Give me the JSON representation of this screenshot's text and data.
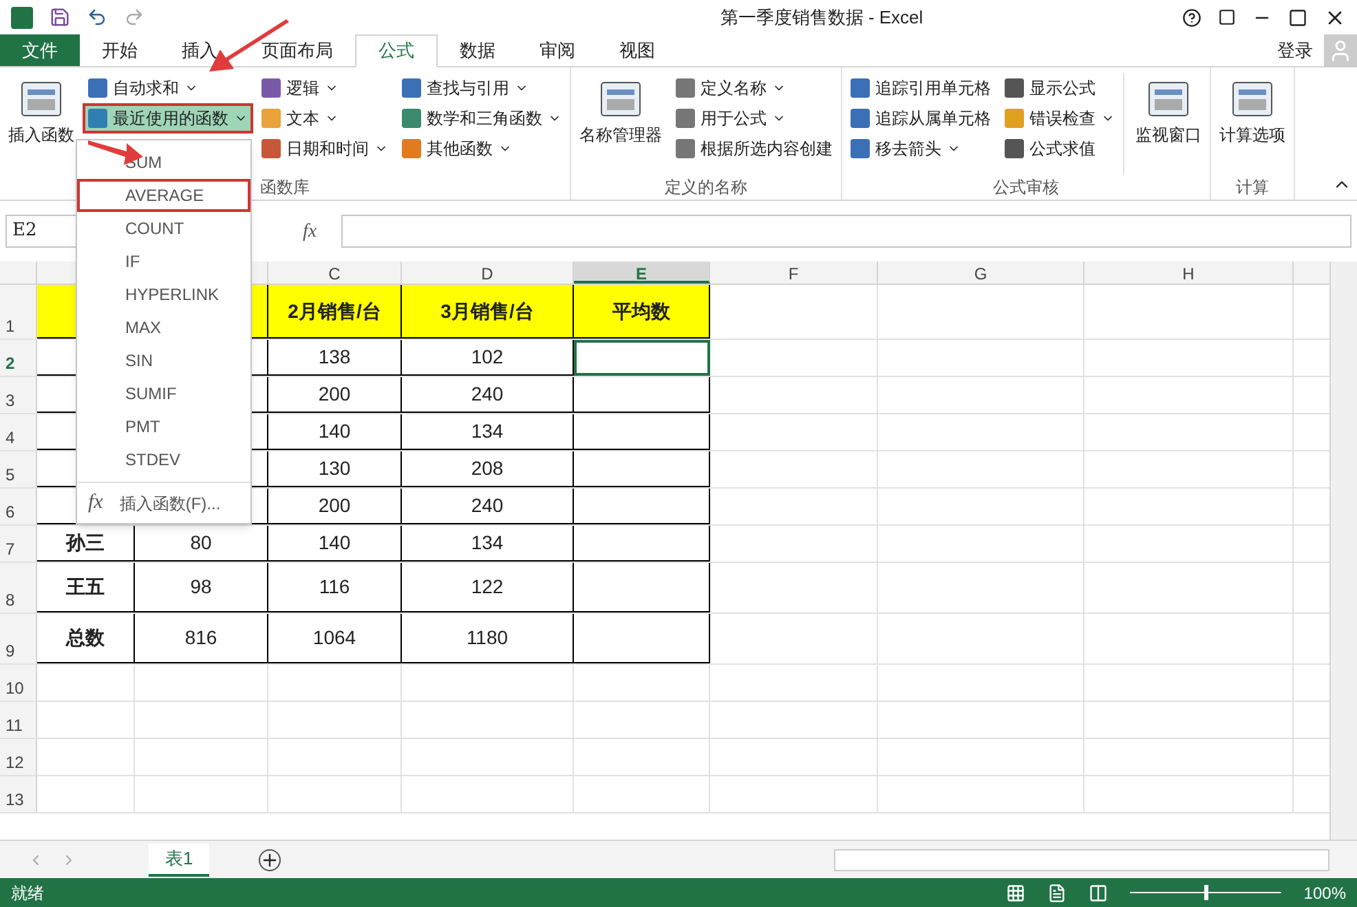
{
  "window": {
    "title": "第一季度销售数据 - Excel",
    "account": "登录"
  },
  "tabs": [
    {
      "label": "文件",
      "kind": "file",
      "selected": false
    },
    {
      "label": "开始",
      "kind": "tab",
      "selected": false
    },
    {
      "label": "插入",
      "kind": "tab",
      "selected": false
    },
    {
      "label": "页面布局",
      "kind": "tab",
      "selected": false
    },
    {
      "label": "公式",
      "kind": "tab",
      "selected": true
    },
    {
      "label": "数据",
      "kind": "tab",
      "selected": false
    },
    {
      "label": "审阅",
      "kind": "tab",
      "selected": false
    },
    {
      "label": "视图",
      "kind": "tab",
      "selected": false
    }
  ],
  "ribbon": [
    {
      "label": "函数库",
      "large": [
        {
          "label": "插入函数"
        }
      ],
      "columns": [
        [
          {
            "label": "自动求和",
            "dropdown": true,
            "selected": false,
            "annotated": false
          },
          {
            "label": "最近使用的函数",
            "dropdown": true,
            "selected": true,
            "annotated": true
          }
        ],
        [
          {
            "label": "逻辑",
            "dropdown": true,
            "selected": false
          },
          {
            "label": "文本",
            "dropdown": true,
            "selected": false
          },
          {
            "label": "日期和时间",
            "dropdown": true,
            "selected": false
          }
        ],
        [
          {
            "label": "查找与引用",
            "dropdown": true,
            "selected": false
          },
          {
            "label": "数学和三角函数",
            "dropdown": true,
            "selected": false
          },
          {
            "label": "其他函数",
            "dropdown": true,
            "selected": false
          }
        ]
      ]
    },
    {
      "label": "定义的名称",
      "large": [
        {
          "label": "名称管理器"
        }
      ],
      "columns": [
        [
          {
            "label": "定义名称",
            "dropdown": true,
            "selected": false
          },
          {
            "label": "用于公式",
            "dropdown": true,
            "selected": false
          },
          {
            "label": "根据所选内容创建",
            "dropdown": false,
            "selected": false
          }
        ]
      ]
    },
    {
      "label": "公式审核",
      "columns": [
        [
          {
            "label": "追踪引用单元格",
            "dropdown": false,
            "selected": false
          },
          {
            "label": "追踪从属单元格",
            "dropdown": false,
            "selected": false
          },
          {
            "label": "移去箭头",
            "dropdown": true,
            "selected": false
          }
        ],
        [
          {
            "label": "显示公式",
            "dropdown": false,
            "selected": false
          },
          {
            "label": "错误检查",
            "dropdown": true,
            "selected": false
          },
          {
            "label": "公式求值",
            "dropdown": false,
            "selected": false
          }
        ]
      ],
      "trailing": [
        {
          "label": "监视窗口"
        }
      ]
    },
    {
      "label": "计算",
      "large": [
        {
          "label": "计算选项"
        }
      ]
    }
  ],
  "menu": {
    "items": [
      {
        "label": "SUM",
        "annotated": false
      },
      {
        "label": "AVERAGE",
        "annotated": true
      },
      {
        "label": "COUNT",
        "annotated": false
      },
      {
        "label": "IF",
        "annotated": false
      },
      {
        "label": "HYPERLINK",
        "annotated": false
      },
      {
        "label": "MAX",
        "annotated": false
      },
      {
        "label": "SIN",
        "annotated": false
      },
      {
        "label": "SUMIF",
        "annotated": false
      },
      {
        "label": "PMT",
        "annotated": false
      },
      {
        "label": "STDEV",
        "annotated": false
      }
    ],
    "footer_icon": "fx",
    "footer": "插入函数(F)..."
  },
  "formula_bar": {
    "name_box": "E2",
    "fx": "fx"
  },
  "columns": [
    {
      "label": "C",
      "selected": false
    },
    {
      "label": "D",
      "selected": false
    },
    {
      "label": "E",
      "selected": true
    },
    {
      "label": "F",
      "selected": false
    },
    {
      "label": "G",
      "selected": false
    },
    {
      "label": "H",
      "selected": false
    }
  ],
  "rows": [
    {
      "number": "1",
      "kind": "header",
      "selected": false,
      "cells": {
        "C": "2月销售/台",
        "D": "3月销售/台",
        "E": "平均数"
      }
    },
    {
      "number": "2",
      "kind": "data",
      "selected": true,
      "cells": {
        "C": "138",
        "D": "102"
      }
    },
    {
      "number": "3",
      "kind": "data",
      "selected": false,
      "cells": {
        "C": "200",
        "D": "240"
      }
    },
    {
      "number": "4",
      "kind": "data",
      "selected": false,
      "cells": {
        "C": "140",
        "D": "134"
      }
    },
    {
      "number": "5",
      "kind": "data",
      "selected": false,
      "cells": {
        "C": "130",
        "D": "208"
      }
    },
    {
      "number": "6",
      "kind": "data",
      "selected": false,
      "cells": {
        "C": "200",
        "D": "240"
      }
    },
    {
      "number": "7",
      "kind": "data",
      "selected": false,
      "cells": {
        "A": "孙三",
        "B": "80",
        "C": "140",
        "D": "134"
      }
    },
    {
      "number": "8",
      "kind": "tall",
      "selected": false,
      "cells": {
        "A": "王五",
        "B": "98",
        "C": "116",
        "D": "122"
      }
    },
    {
      "number": "9",
      "kind": "tall",
      "selected": false,
      "cells": {
        "A": "总数",
        "B": "816",
        "C": "1064",
        "D": "1180"
      }
    },
    {
      "number": "10",
      "kind": "empty",
      "selected": false,
      "cells": {}
    },
    {
      "number": "11",
      "kind": "empty",
      "selected": false,
      "cells": {}
    },
    {
      "number": "12",
      "kind": "empty",
      "selected": false,
      "cells": {}
    },
    {
      "number": "13",
      "kind": "empty",
      "selected": false,
      "cells": {}
    }
  ],
  "sheets": [
    {
      "label": "表1",
      "selected": true
    }
  ],
  "status": {
    "text": "就绪",
    "zoom": "100%",
    "level": 0.5
  }
}
